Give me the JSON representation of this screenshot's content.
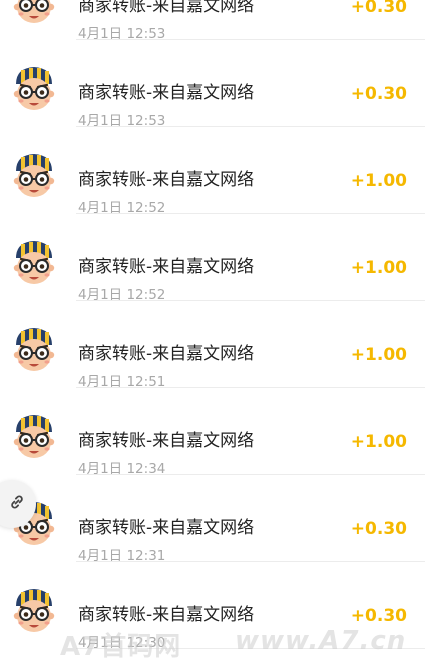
{
  "colors": {
    "amount": "#f5b800",
    "title": "#222222",
    "time": "#a8a8a8",
    "divider": "#ececec"
  },
  "transactions": [
    {
      "title": "商家转账-来自嘉文网络",
      "time": "4月1日 12:53",
      "amount": "+0.30",
      "avatar_icon": "cartoon-avatar-icon"
    },
    {
      "title": "商家转账-来自嘉文网络",
      "time": "4月1日 12:53",
      "amount": "+0.30",
      "avatar_icon": "cartoon-avatar-icon"
    },
    {
      "title": "商家转账-来自嘉文网络",
      "time": "4月1日 12:52",
      "amount": "+1.00",
      "avatar_icon": "cartoon-avatar-icon"
    },
    {
      "title": "商家转账-来自嘉文网络",
      "time": "4月1日 12:52",
      "amount": "+1.00",
      "avatar_icon": "cartoon-avatar-icon"
    },
    {
      "title": "商家转账-来自嘉文网络",
      "time": "4月1日 12:51",
      "amount": "+1.00",
      "avatar_icon": "cartoon-avatar-icon"
    },
    {
      "title": "商家转账-来自嘉文网络",
      "time": "4月1日 12:34",
      "amount": "+1.00",
      "avatar_icon": "cartoon-avatar-icon"
    },
    {
      "title": "商家转账-来自嘉文网络",
      "time": "4月1日 12:31",
      "amount": "+0.30",
      "avatar_icon": "cartoon-avatar-icon"
    },
    {
      "title": "商家转账-来自嘉文网络",
      "time": "4月1日 12:30",
      "amount": "+0.30",
      "avatar_icon": "cartoon-avatar-icon"
    }
  ],
  "floating_button": {
    "icon": "link-icon"
  },
  "watermark": {
    "left_text": "A7首码网",
    "right_text": "www.A7.cn"
  }
}
